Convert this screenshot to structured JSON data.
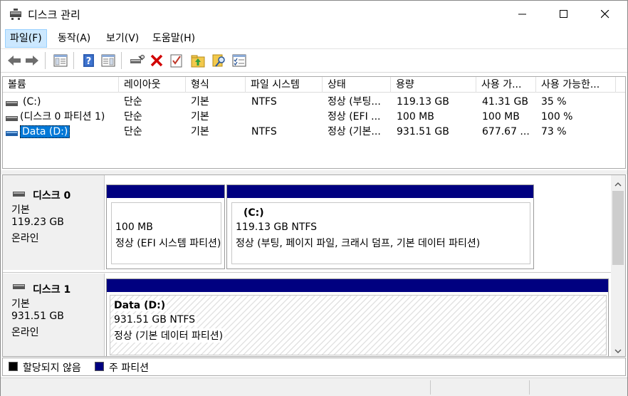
{
  "window": {
    "title": "디스크 관리"
  },
  "menu": [
    "파일(F)",
    "동작(A)",
    "보기(V)",
    "도움말(H)"
  ],
  "toolbar": {
    "buttons": [
      "back-icon",
      "forward-icon",
      "console-tree-icon",
      "help-icon",
      "action-pane-icon",
      "connect-drive-icon",
      "delete-icon",
      "checkmark-icon",
      "up-folder-icon",
      "search-icon",
      "properties-icon"
    ]
  },
  "volume_list": {
    "columns": [
      "볼륨",
      "레이아웃",
      "형식",
      "파일 시스템",
      "상태",
      "용량",
      "사용 가...",
      "사용 가능한..."
    ],
    "rows": [
      {
        "volume": "(C:)",
        "layout": "단순",
        "type": "기본",
        "fs": "NTFS",
        "status": "정상 (부팅...",
        "capacity": "119.13 GB",
        "free": "41.31 GB",
        "pct": "35 %"
      },
      {
        "volume": "(디스크 0 파티션 1)",
        "layout": "단순",
        "type": "기본",
        "fs": "",
        "status": "정상 (EFI ...",
        "capacity": "100 MB",
        "free": "100 MB",
        "pct": "100 %"
      },
      {
        "volume": "Data (D:)",
        "layout": "단순",
        "type": "기본",
        "fs": "NTFS",
        "status": "정상 (기본...",
        "capacity": "931.51 GB",
        "free": "677.67 ...",
        "pct": "73 %"
      }
    ]
  },
  "disks": [
    {
      "name": "디스크 0",
      "type": "기본",
      "size": "119.23 GB",
      "state": "온라인",
      "partitions": [
        {
          "label": "",
          "size": "100 MB",
          "status": "정상 (EFI 시스템 파티션)"
        },
        {
          "label": "(C:)",
          "size": "119.13 GB NTFS",
          "status": "정상 (부팅, 페이지 파일, 크래시 덤프, 기본 데이터 파티션)"
        }
      ]
    },
    {
      "name": "디스크 1",
      "type": "기본",
      "size": "931.51 GB",
      "state": "온라인",
      "partitions": [
        {
          "label": "Data  (D:)",
          "size": "931.51 GB NTFS",
          "status": "정상 (기본 데이터 파티션)"
        }
      ]
    }
  ],
  "legend": [
    {
      "label": "할당되지 않음",
      "color": "#000000"
    },
    {
      "label": "주 파티션",
      "color": "#000080"
    }
  ],
  "colors": {
    "primary_partition": "#000080",
    "selection": "#0078d7",
    "menu_highlight": "#cce8ff"
  }
}
